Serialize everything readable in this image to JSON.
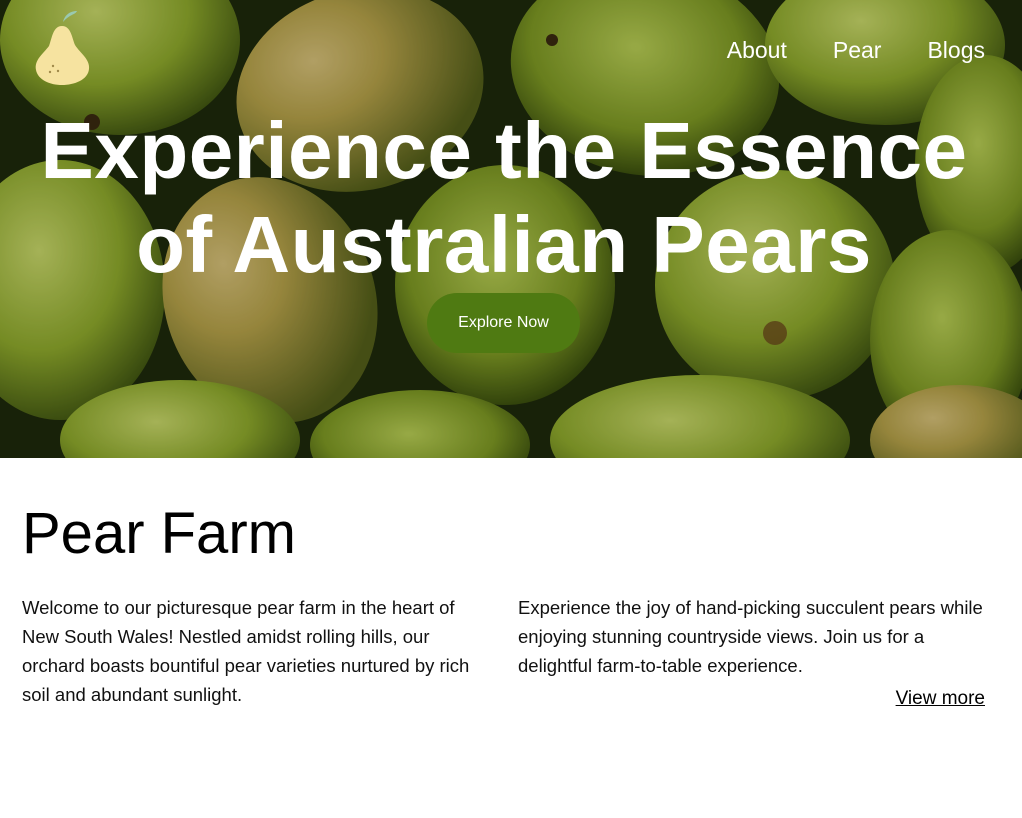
{
  "nav": {
    "items": [
      {
        "label": "About"
      },
      {
        "label": "Pear"
      },
      {
        "label": "Blogs"
      }
    ]
  },
  "hero": {
    "headline_line1": "Experience the Essence",
    "headline_line2": "of Australian Pears",
    "cta_label": "Explore Now",
    "image_icon": "pears-background-photo"
  },
  "logo": {
    "icon": "pear-logo-icon"
  },
  "farm": {
    "title": "Pear Farm",
    "paragraph_left": "Welcome to our picturesque pear farm in the heart of New South Wales! Nestled amidst rolling hills, our orchard boasts bountiful pear varieties nurtured by rich soil and abundant sunlight.",
    "paragraph_right": "Experience the joy of hand-picking succulent pears while enjoying stunning countryside views. Join us for a delightful farm-to-table experience.",
    "view_more_label": "View more"
  },
  "colors": {
    "cta_background": "#4f7a12",
    "logo_pear": "#f6e3a0",
    "logo_leaf": "#9ac9b0"
  }
}
